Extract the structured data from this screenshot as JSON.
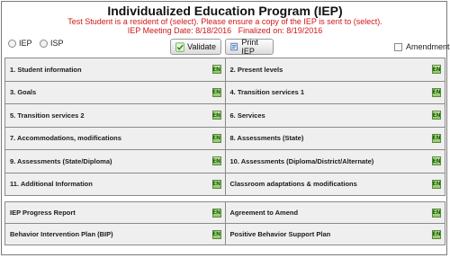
{
  "header": {
    "title": "Individualized Education Program (IEP)",
    "notice": "Test Student is a resident of (select). Please ensure a copy of the IEP is sent to (select).",
    "meeting_date": "IEP Meeting Date: 8/18/2016",
    "finalized_on": "Finalized on: 8/19/2016"
  },
  "program_type": {
    "options": [
      "IEP",
      "ISP"
    ]
  },
  "toolbar": {
    "validate_label": "Validate",
    "print_label": "Print IEP",
    "amendment_label": "Amendment"
  },
  "icons": {
    "en_badge_text": "EN",
    "validate_icon": "check-icon",
    "print_icon": "document-icon"
  },
  "sections": [
    [
      "1. Student information",
      "2. Present levels"
    ],
    [
      "3. Goals",
      "4. Transition services 1"
    ],
    [
      "5. Transition services 2",
      "6. Services"
    ],
    [
      "7. Accommodations, modifications",
      "8. Assessments (State)"
    ],
    [
      "9. Assessments (State/Diploma)",
      "10. Assessments (Diploma/District/Alternate)"
    ],
    [
      "11. Additional Information",
      "Classroom adaptations & modifications"
    ]
  ],
  "reports": [
    [
      "IEP Progress Report",
      "Agreement to Amend"
    ],
    [
      "Behavior Intervention Plan (BIP)",
      "Positive Behavior Support Plan"
    ]
  ],
  "colors": {
    "notice_text": "#d01818",
    "cell_bg": "#efefef",
    "badge_green": "#8cc866"
  }
}
